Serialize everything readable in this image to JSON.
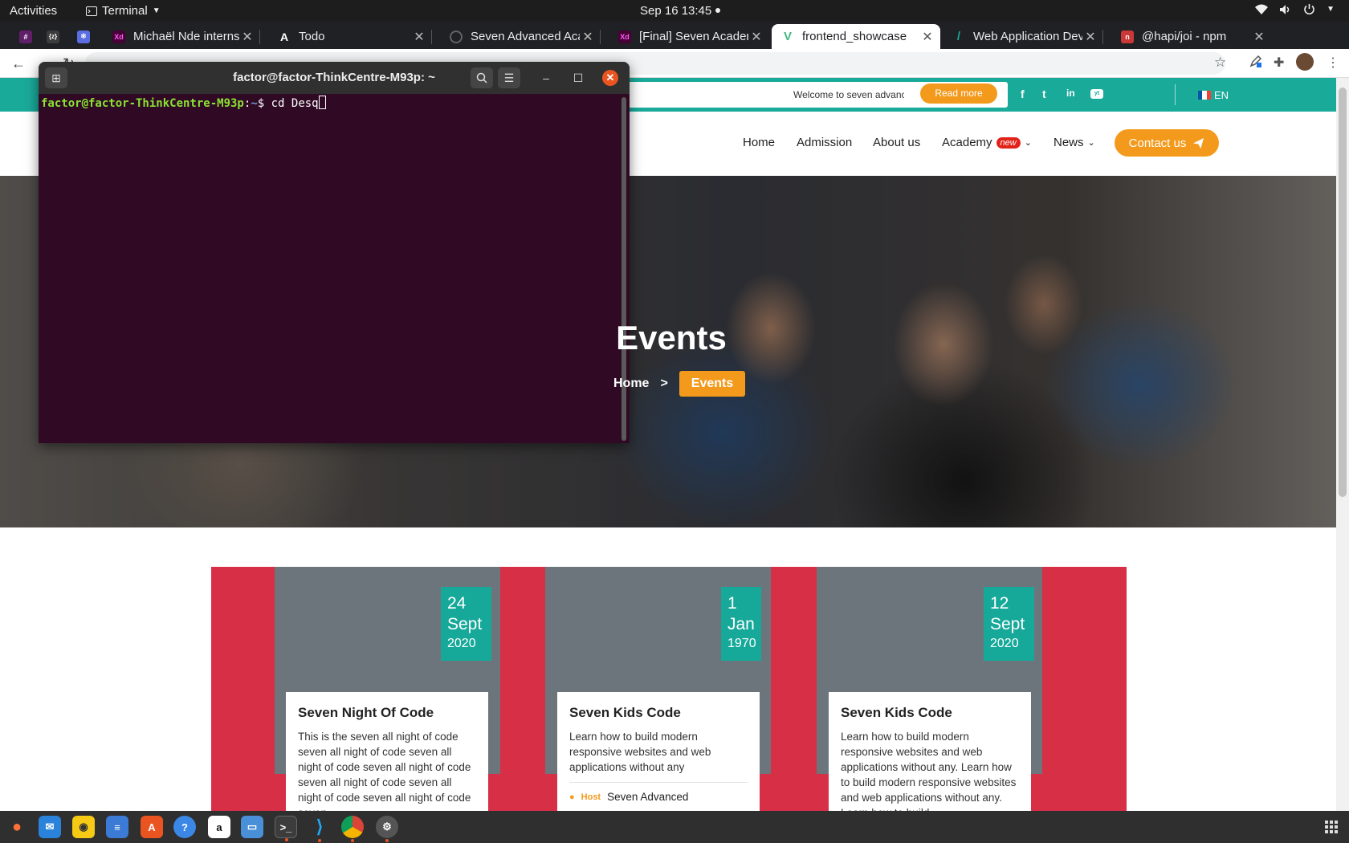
{
  "topbar": {
    "activities": "Activities",
    "app_name": "Terminal",
    "clock": "Sep 16  13:45"
  },
  "tabs": [
    {
      "label": "Michaël Nde interns",
      "icon": "adobe-xd-icon",
      "color": "#470137"
    },
    {
      "label": "Todo",
      "icon": "todo-icon",
      "color": "#202124"
    },
    {
      "label": "Seven Advanced Aca",
      "icon": "loading-icon",
      "color": "#202124"
    },
    {
      "label": "[Final] Seven Academ",
      "icon": "adobe-xd-icon",
      "color": "#470137"
    },
    {
      "label": "frontend_showcase",
      "icon": "vue-icon",
      "color": "#41b883"
    },
    {
      "label": "Web Application Dev",
      "icon": "feather-icon",
      "color": "#16a99a"
    },
    {
      "label": "@hapi/joi - npm",
      "icon": "npm-icon",
      "color": "#cb3837"
    }
  ],
  "website": {
    "welcome": "Welcome to seven advanced academy",
    "read_more": "Read more",
    "social": [
      "f",
      "t",
      "in",
      "yt"
    ],
    "lang": "EN",
    "nav": {
      "home": "Home",
      "admission": "Admission",
      "about": "About us",
      "academy": "Academy",
      "academy_badge": "new",
      "news": "News",
      "contact": "Contact us"
    },
    "hero": {
      "title": "Events",
      "crumb_home": "Home",
      "crumb_sep": ">",
      "crumb_current": "Events"
    },
    "events": [
      {
        "day": "24",
        "month": "Sept",
        "year": "2020",
        "title": "Seven Night Of Code",
        "desc": "This is the seven all night of code seven all night of code seven all night of code seven all night of code seven all night of code seven all night of code seven all night of code seven",
        "host_label": "",
        "host": ""
      },
      {
        "day": "1",
        "month": "Jan",
        "year": "1970",
        "title": "Seven Kids Code",
        "desc": "Learn how to build modern responsive websites and web applications without any",
        "host_label": "Host",
        "host": "Seven Advanced"
      },
      {
        "day": "12",
        "month": "Sept",
        "year": "2020",
        "title": "Seven Kids Code",
        "desc": "Learn how to build modern responsive websites and web applications without any. Learn how to build modern responsive websites and web applications without any. Learn how to build",
        "host_label": "",
        "host": ""
      }
    ]
  },
  "terminal": {
    "title": "factor@factor-ThinkCentre-M93p: ~",
    "prompt_user": "factor@factor-ThinkCentre-M93p",
    "prompt_path": "~",
    "command": "cd Desq"
  },
  "colors": {
    "teal": "#1aaa9a",
    "orange": "#f39a1c",
    "red": "#d62f46",
    "terminal_bg": "#300a24"
  }
}
